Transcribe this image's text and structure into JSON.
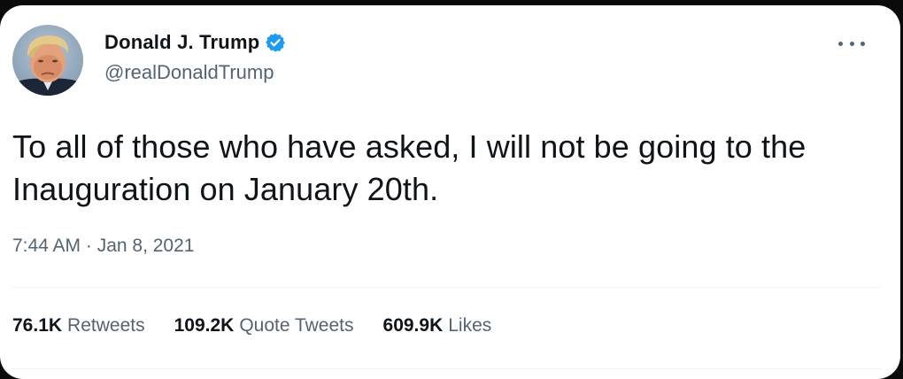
{
  "author": {
    "display_name": "Donald J. Trump",
    "handle": "@realDonaldTrump",
    "verified": true,
    "avatar_icon": "profile-photo"
  },
  "tweet": {
    "text": "To all of those who have asked, I will not be going to the Inauguration on January 20th.",
    "timestamp": "7:44 AM · Jan 8, 2021"
  },
  "stats": {
    "retweets_count": "76.1K",
    "retweets_label": "Retweets",
    "quotes_count": "109.2K",
    "quotes_label": "Quote Tweets",
    "likes_count": "609.9K",
    "likes_label": "Likes"
  },
  "colors": {
    "primary_text": "#0f1419",
    "secondary_text": "#536471",
    "verified_blue": "#1d9bf0",
    "divider": "#eff3f4",
    "background": "#ffffff"
  },
  "icons": {
    "verified": "verified-badge-icon",
    "more": "more-options-icon"
  }
}
